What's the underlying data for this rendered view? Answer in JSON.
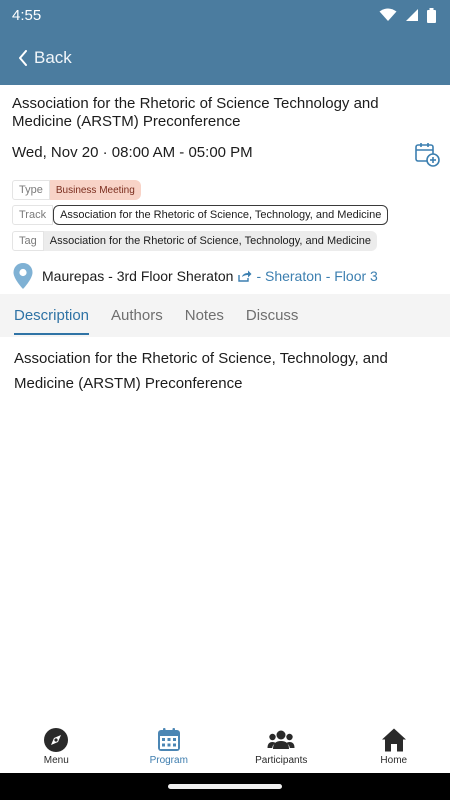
{
  "status_bar": {
    "time": "4:55"
  },
  "header": {
    "back_label": "Back"
  },
  "event": {
    "title": "Association for the Rhetoric of Science Technology and Medicine (ARSTM) Preconference",
    "datetime": "Wed, Nov 20 · 08:00 AM - 05:00 PM",
    "meta": [
      {
        "key": "Type",
        "value": "Business Meeting"
      },
      {
        "key": "Track",
        "value": "Association for the Rhetoric of Science, Technology, and Medicine"
      },
      {
        "key": "Tag",
        "value": "Association for the Rhetoric of Science, Technology, and Medicine"
      }
    ],
    "location": {
      "room": "Maurepas - 3rd Floor Sheraton",
      "link": "- Sheraton - Floor 3"
    }
  },
  "tabs": [
    {
      "label": "Description",
      "active": true
    },
    {
      "label": "Authors",
      "active": false
    },
    {
      "label": "Notes",
      "active": false
    },
    {
      "label": "Discuss",
      "active": false
    }
  ],
  "description": "Association for the Rhetoric of Science, Technology, and Medicine (ARSTM) Preconference",
  "bottom_nav": [
    {
      "label": "Menu",
      "icon": "compass-icon",
      "active": false
    },
    {
      "label": "Program",
      "icon": "calendar-icon",
      "active": true
    },
    {
      "label": "Participants",
      "icon": "people-icon",
      "active": false
    },
    {
      "label": "Home",
      "icon": "home-icon",
      "active": false
    }
  ],
  "colors": {
    "header_bg": "#4b7c9f",
    "accent": "#2f73a5",
    "type_badge_bg": "#f8d3c7",
    "tab_bar_bg": "#f4f4f4"
  }
}
